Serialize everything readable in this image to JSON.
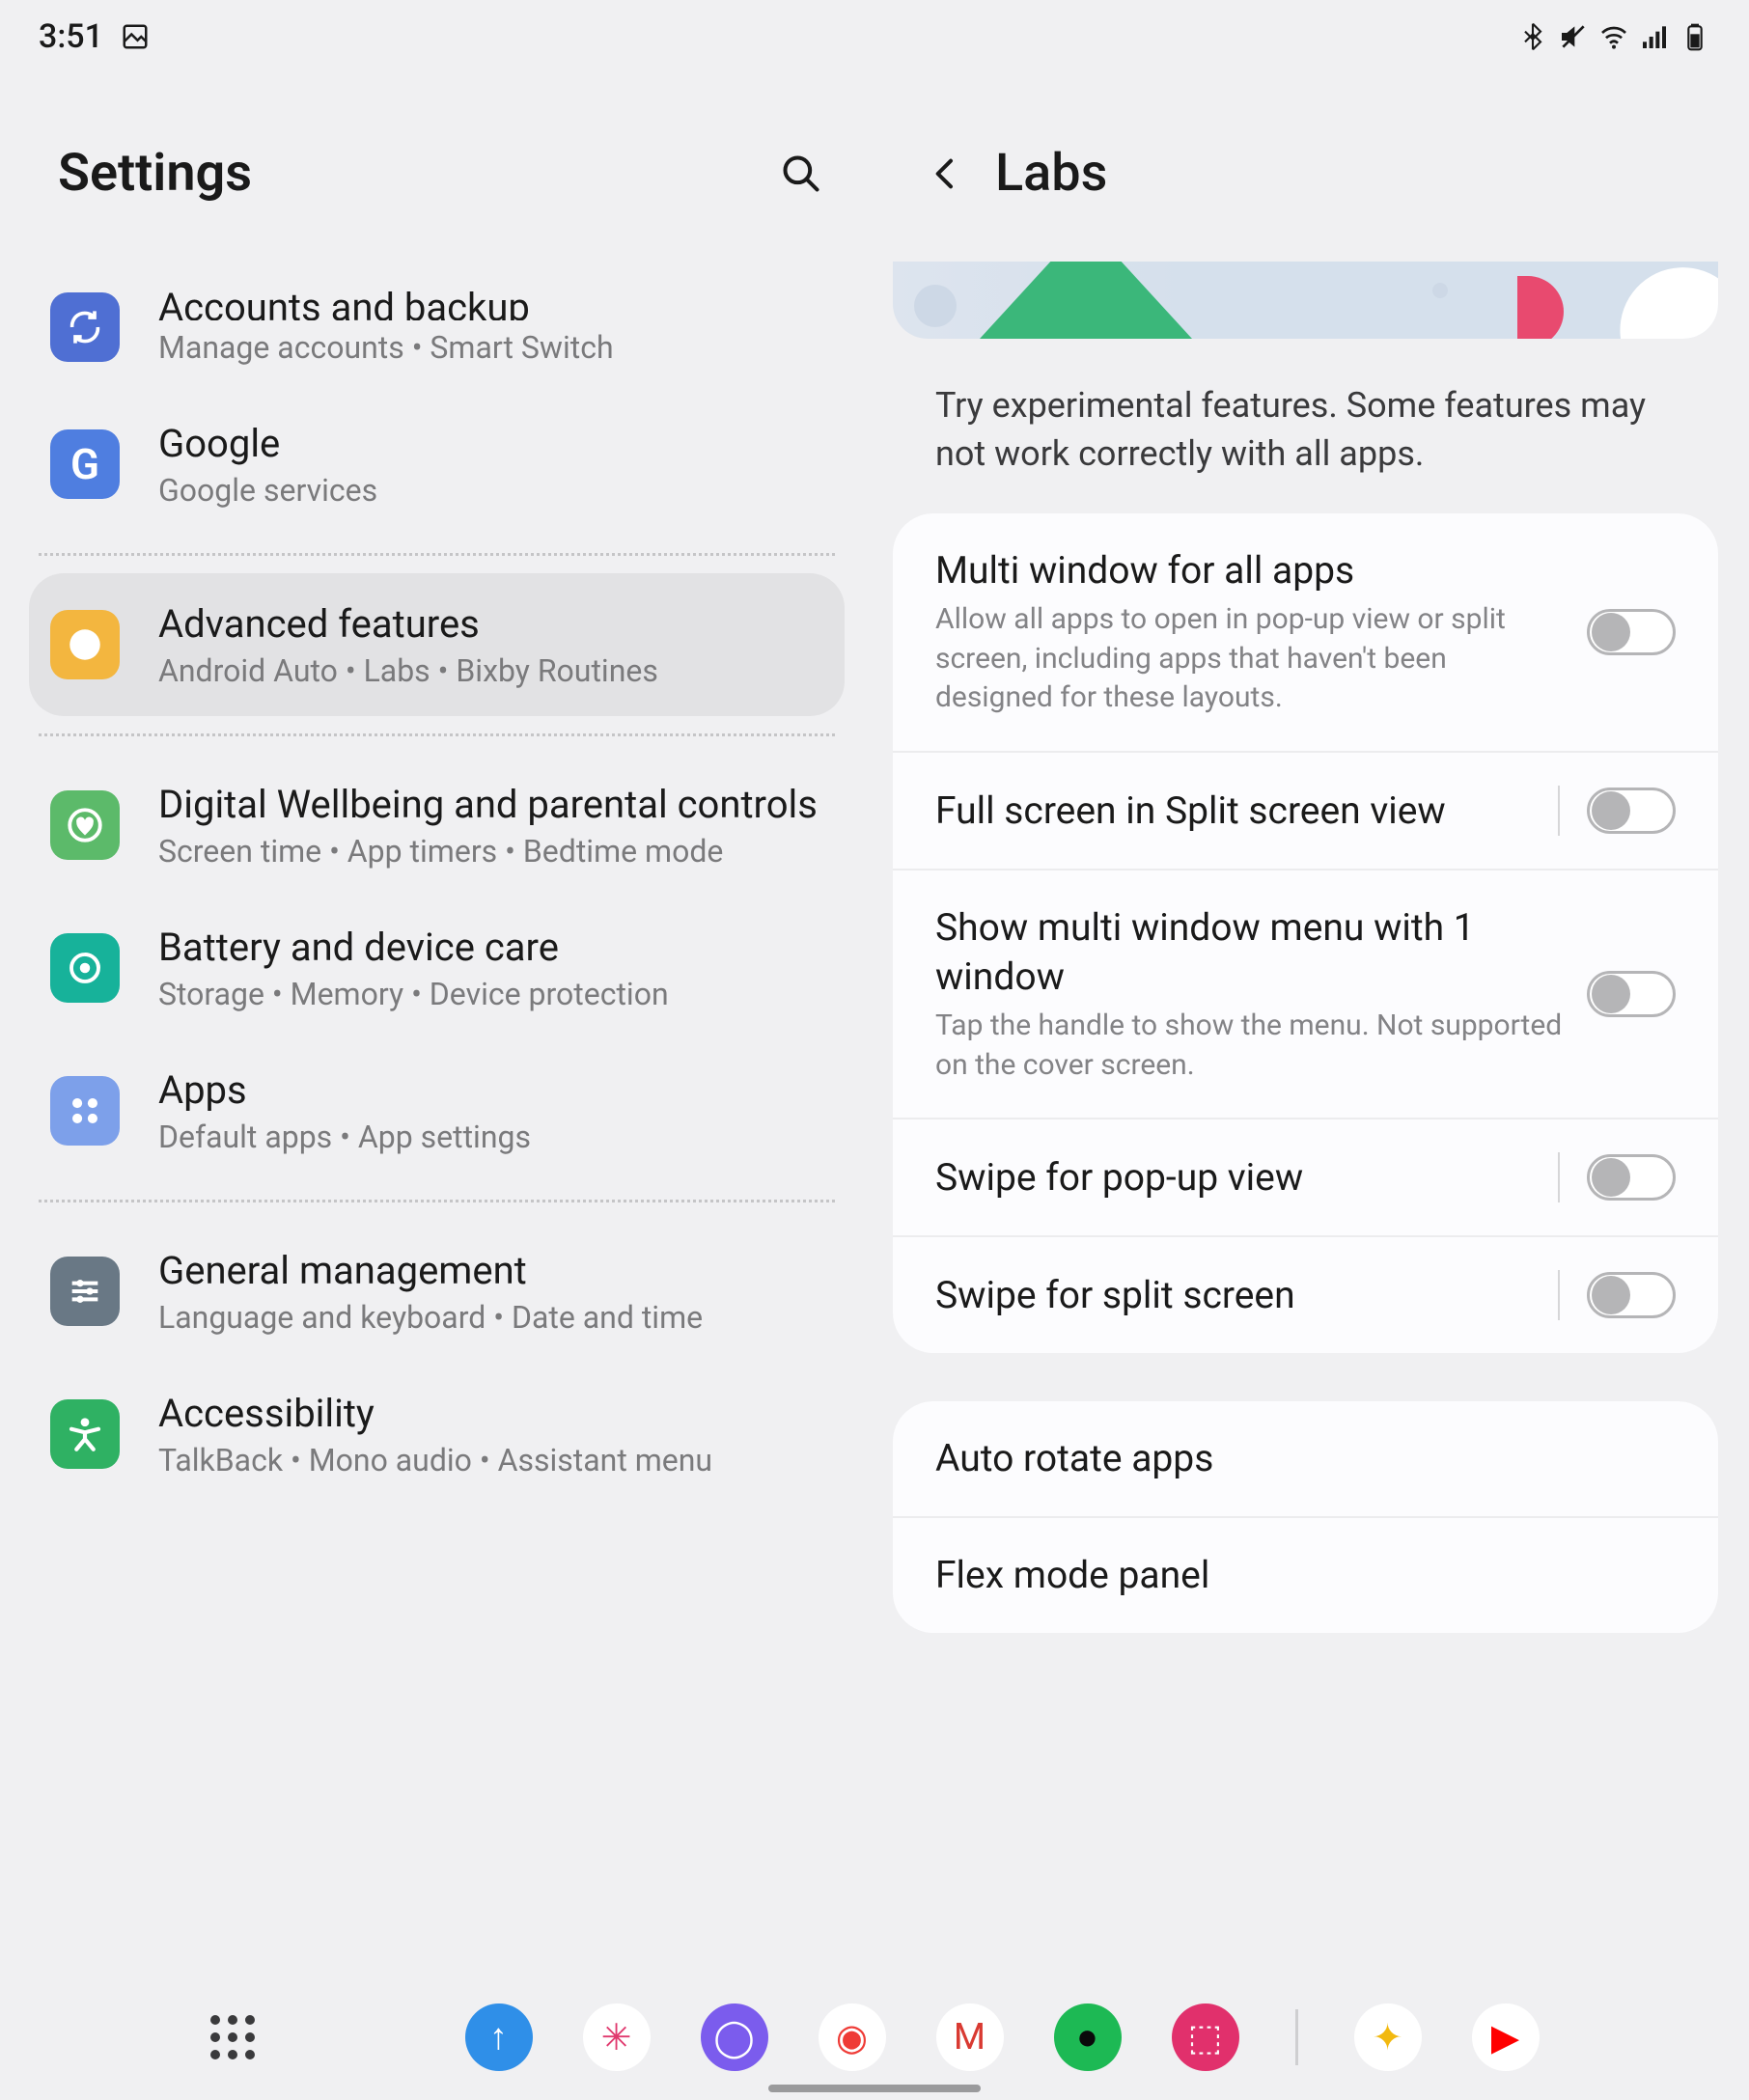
{
  "status": {
    "time": "3:51"
  },
  "leftPane": {
    "title": "Settings",
    "items": [
      {
        "title": "Accounts and backup",
        "subtitle": "Manage accounts  •  Smart Switch",
        "iconBg": "#4f6fd3",
        "iconName": "sync-icon",
        "cutoff": true
      },
      {
        "title": "Google",
        "subtitle": "Google services",
        "iconBg": "#4f7ee0",
        "iconName": "google-icon"
      },
      {
        "divider": true
      },
      {
        "title": "Advanced features",
        "subtitle": "Android Auto  •  Labs  •  Bixby Routines",
        "iconBg": "#f3b63f",
        "iconName": "gear-plus-icon",
        "selected": true
      },
      {
        "divider": true
      },
      {
        "title": "Digital Wellbeing and parental controls",
        "subtitle": "Screen time  •  App timers  •  Bedtime mode",
        "iconBg": "#5cba6a",
        "iconName": "wellbeing-icon"
      },
      {
        "title": "Battery and device care",
        "subtitle": "Storage  •  Memory  •  Device protection",
        "iconBg": "#17b29a",
        "iconName": "device-care-icon"
      },
      {
        "title": "Apps",
        "subtitle": "Default apps  •  App settings",
        "iconBg": "#7da0ea",
        "iconName": "apps-icon"
      },
      {
        "divider": true
      },
      {
        "title": "General management",
        "subtitle": "Language and keyboard  •  Date and time",
        "iconBg": "#697885",
        "iconName": "sliders-icon"
      },
      {
        "title": "Accessibility",
        "subtitle": "TalkBack  •  Mono audio  •  Assistant menu",
        "iconBg": "#2fb163",
        "iconName": "accessibility-icon"
      }
    ]
  },
  "rightPane": {
    "title": "Labs",
    "intro": "Try experimental features. Some features may not work correctly with all apps.",
    "group1": [
      {
        "title": "Multi window for all apps",
        "desc": "Allow all apps to open in pop-up view or split screen, including apps that haven't been designed for these layouts.",
        "toggle": false,
        "vdiv": false
      },
      {
        "title": "Full screen in Split screen view",
        "toggle": false,
        "vdiv": true
      },
      {
        "title": "Show multi window menu with 1 window",
        "desc": "Tap the handle to show the menu. Not supported on the cover screen.",
        "toggle": false,
        "vdiv": false
      },
      {
        "title": "Swipe for pop-up view",
        "toggle": false,
        "vdiv": true
      },
      {
        "title": "Swipe for split screen",
        "toggle": false,
        "vdiv": true
      }
    ],
    "group2": [
      {
        "title": "Auto rotate apps"
      },
      {
        "title": "Flex mode panel"
      }
    ]
  },
  "taskbar": {
    "apps": [
      {
        "name": "upload-app",
        "bg": "#2f8fe8",
        "glyph": "↑"
      },
      {
        "name": "slack-app",
        "bg": "#ffffff",
        "glyph": "✳",
        "fg": "#e0396e"
      },
      {
        "name": "browser-app",
        "bg": "#7b5ced",
        "glyph": "◯"
      },
      {
        "name": "pocketcasts-app",
        "bg": "#ffffff",
        "glyph": "◉",
        "fg": "#ef3b36"
      },
      {
        "name": "gmail-app",
        "bg": "#ffffff",
        "glyph": "M",
        "fg": "#d93a32"
      },
      {
        "name": "spotify-app",
        "bg": "#1db954",
        "glyph": "●",
        "fg": "#0a0a0a"
      },
      {
        "name": "instagram-app",
        "bg": "#e1306c",
        "glyph": "⬚"
      }
    ],
    "recent": [
      {
        "name": "photos-app",
        "bg": "#ffffff",
        "glyph": "✦",
        "fg": "#f2b90f"
      },
      {
        "name": "youtube-app",
        "bg": "#ffffff",
        "glyph": "▶",
        "fg": "#ff0000"
      }
    ]
  }
}
